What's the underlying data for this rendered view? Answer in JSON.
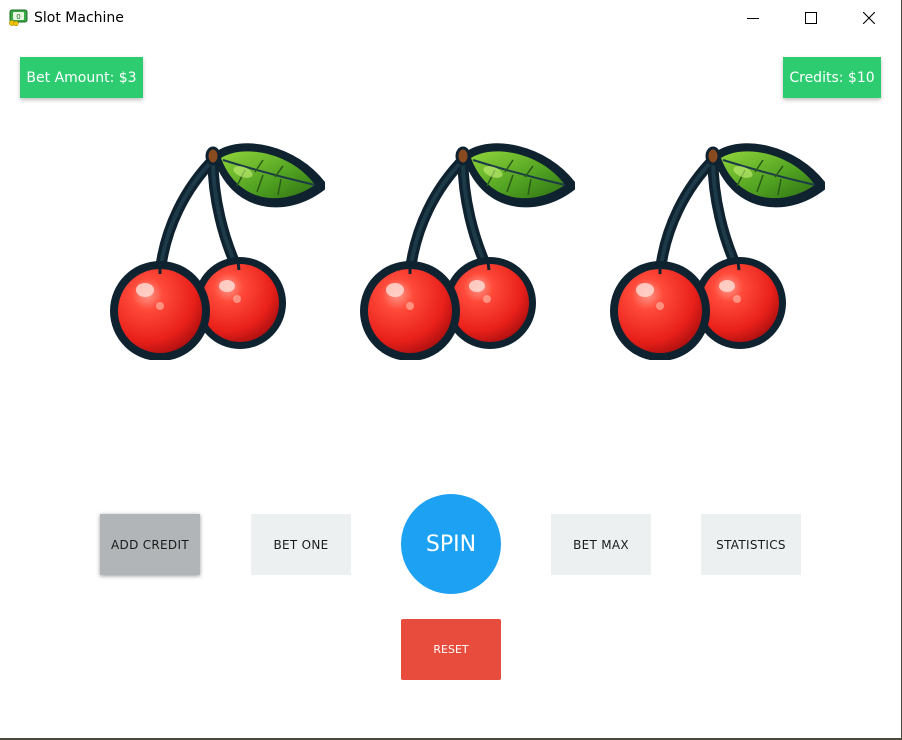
{
  "window": {
    "title": "Slot Machine",
    "app_icon": "money-icon",
    "controls": [
      "minimize-icon",
      "maximize-icon",
      "close-icon"
    ]
  },
  "status": {
    "bet_amount": "Bet Amount: $3",
    "credits": "Credits: $10"
  },
  "reels": [
    {
      "symbol": "cherry"
    },
    {
      "symbol": "cherry"
    },
    {
      "symbol": "cherry"
    }
  ],
  "buttons": {
    "add_credit": "ADD CREDIT",
    "bet_one": "BET ONE",
    "spin": "SPIN",
    "bet_max": "BET MAX",
    "statistics": "STATISTICS",
    "reset": "RESET"
  },
  "colors": {
    "badge_green": "#2ecc71",
    "spin_blue": "#1da1f2",
    "reset_red": "#e74c3c",
    "button_light": "#ecf0f1",
    "button_active": "#b1b5b7"
  }
}
